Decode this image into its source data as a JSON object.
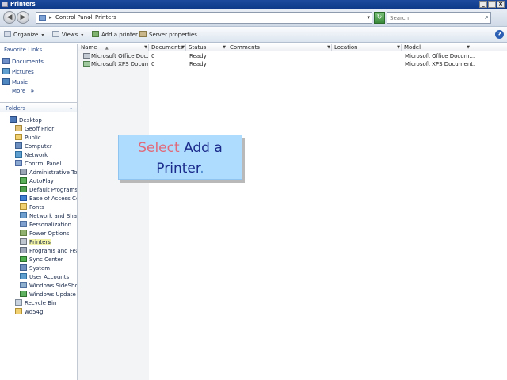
{
  "window": {
    "title": "Printers",
    "controls": {
      "minimize": "_",
      "maximize": "□",
      "close": "×"
    }
  },
  "address": {
    "crumbs": [
      "Control Panel",
      "Printers"
    ],
    "separator": "▸",
    "dropdown": "▾",
    "back": "◀",
    "forward": "▶",
    "refresh": "↻"
  },
  "search": {
    "placeholder": "Search",
    "icon": "search-icon"
  },
  "toolbar": {
    "organize": "Organize",
    "views": "Views",
    "add_printer": "Add a printer",
    "server_properties": "Server properties",
    "help": "?"
  },
  "favorites": {
    "title": "Favorite Links",
    "items": [
      "Documents",
      "Pictures",
      "Music"
    ],
    "more": "More",
    "more_chevron": "»"
  },
  "folders": {
    "title": "Folders",
    "chevron": "⌄",
    "items": [
      "Desktop",
      "Geoff Prior",
      "Public",
      "Computer",
      "Network",
      "Control Panel",
      "Administrative Tools",
      "AutoPlay",
      "Default Programs",
      "Ease of Access Center",
      "Fonts",
      "Network and Sharing Center",
      "Personalization",
      "Power Options",
      "Printers",
      "Programs and Features",
      "Sync Center",
      "System",
      "User Accounts",
      "Windows SideShow",
      "Windows Update",
      "Recycle Bin",
      "wd54g"
    ]
  },
  "columns": [
    "Name",
    "Documents",
    "Status",
    "Comments",
    "Location",
    "Model"
  ],
  "sort_arrow": "▲",
  "printers": [
    {
      "name": "Microsoft Office Doc...",
      "documents": "0",
      "status": "Ready",
      "model": "Microsoft Office Docum..."
    },
    {
      "name": "Microsoft XPS Docum...",
      "documents": "0",
      "status": "Ready",
      "model": "Microsoft XPS Document..."
    }
  ],
  "callout": {
    "word1": "Select",
    "word2": "Add a",
    "word3": "Printer",
    "dot": "."
  },
  "colors": {
    "titlebar": "#1d4a9c",
    "callout_bg": "#aedcff",
    "callout_accent": "#e06a7a",
    "callout_text": "#1a2a8a"
  }
}
